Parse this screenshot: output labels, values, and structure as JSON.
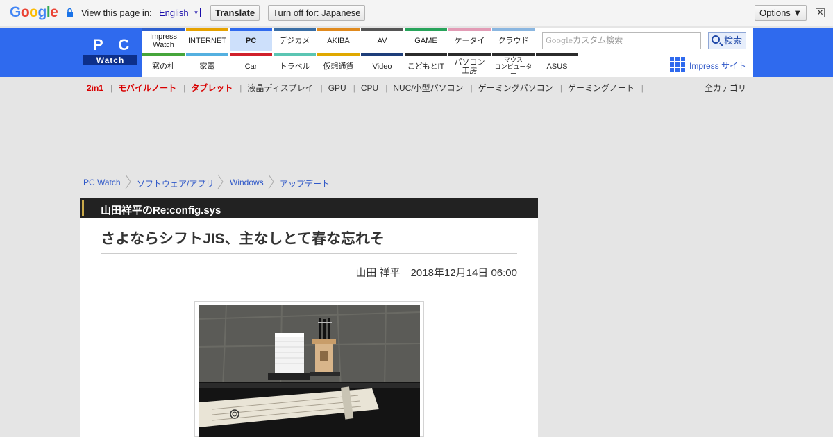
{
  "translate_bar": {
    "logo": "Google",
    "view_text": "View this page in:",
    "language": "English",
    "dropdown_glyph": "▾",
    "translate_button": "Translate",
    "turn_off_button": "Turn off for: Japanese",
    "options_button": "Options ▼",
    "close_glyph": "✕"
  },
  "logo": {
    "top": "P C",
    "bottom": "Watch"
  },
  "nav": {
    "row1": [
      "Impress\nWatch",
      "INTERNET",
      "PC",
      "デジカメ",
      "AKIBA",
      "AV",
      "GAME",
      "ケータイ",
      "クラウド"
    ],
    "row2": [
      "窓の杜",
      "家電",
      "Car",
      "トラベル",
      "仮想通貨",
      "Video",
      "こどもとIT",
      "パソコン\n工房",
      "マウス\nコンピューター",
      "ASUS"
    ],
    "row1_colors": [
      "#2d5fcf",
      "#e6a200",
      "#2f6aee",
      "#3a6ea5",
      "#e08a1e",
      "#555555",
      "#27a35a",
      "#e29bb5",
      "#8ab6e0"
    ],
    "row2_colors": [
      "#46a53b",
      "#54b0e0",
      "#d0202b",
      "#5bc5b3",
      "#e0a800",
      "#1e3e7a",
      "#2b2b2b",
      "#2b2b2b",
      "#2b2b2b",
      "#2b2b2b"
    ]
  },
  "search": {
    "brand": "Google",
    "placeholder": "カスタム検索",
    "button": "検索"
  },
  "impress_link": "Impress サイト",
  "subnav": {
    "items": [
      "2in1",
      "モバイルノート",
      "タブレット",
      "液晶ディスプレイ",
      "GPU",
      "CPU",
      "NUC/小型パソコン",
      "ゲーミングパソコン",
      "ゲーミングノート"
    ],
    "all": "全カテゴリ"
  },
  "breadcrumb": [
    "PC Watch",
    "ソフトウェア/アプリ",
    "Windows",
    "アップデート"
  ],
  "article": {
    "series": "山田祥平のRe:config.sys",
    "title": "さよならシフトJIS、主なしとて春な忘れそ",
    "author": "山田 祥平",
    "date": "2018年12月14日 06:00"
  }
}
